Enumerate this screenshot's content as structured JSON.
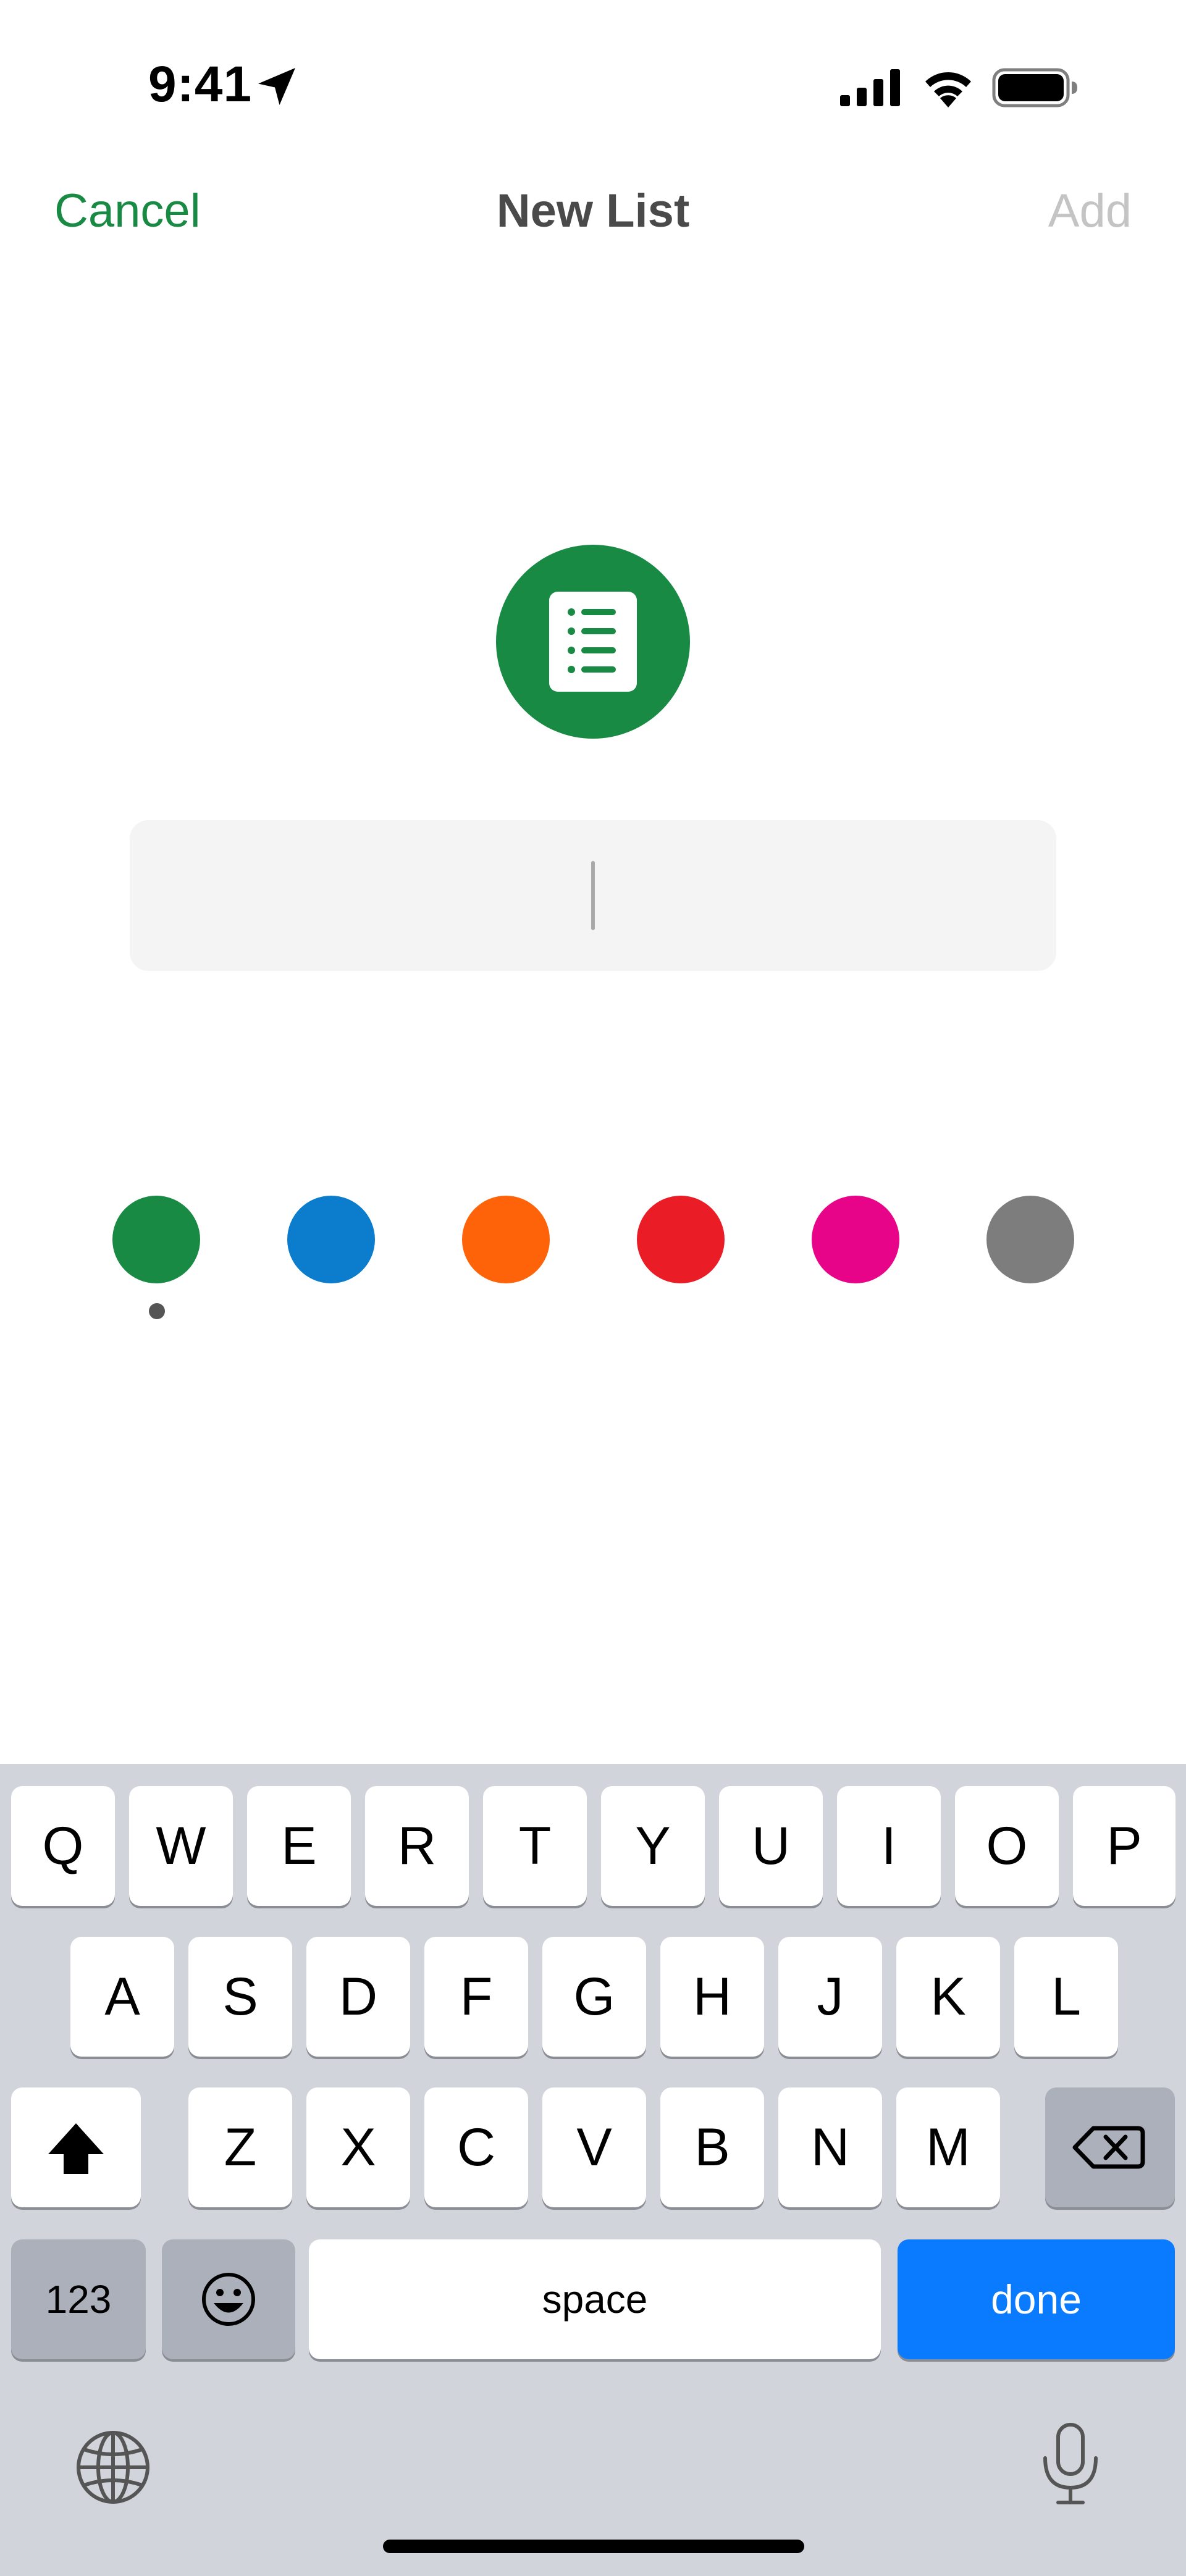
{
  "status_bar": {
    "time": "9:41"
  },
  "nav": {
    "cancel_label": "Cancel",
    "title": "New List",
    "add_label": "Add"
  },
  "list_icon": {
    "name": "list-icon",
    "background": "#198a44"
  },
  "name_input": {
    "value": "",
    "placeholder": ""
  },
  "colors": {
    "selected_index": 0,
    "swatches": [
      "#198a44",
      "#0c7ccc",
      "#fe6309",
      "#ea1c26",
      "#e70488",
      "#7d7d7d"
    ]
  },
  "keyboard": {
    "row1": [
      "Q",
      "W",
      "E",
      "R",
      "T",
      "Y",
      "U",
      "I",
      "O",
      "P"
    ],
    "row2": [
      "A",
      "S",
      "D",
      "F",
      "G",
      "H",
      "J",
      "K",
      "L"
    ],
    "row3": [
      "Z",
      "X",
      "C",
      "V",
      "B",
      "N",
      "M"
    ],
    "numbers_label": "123",
    "space_label": "space",
    "done_label": "done",
    "accent": "#0a7aff",
    "icons": [
      "shift-icon",
      "backspace-icon",
      "emoji-icon",
      "globe-icon",
      "microphone-icon"
    ]
  }
}
